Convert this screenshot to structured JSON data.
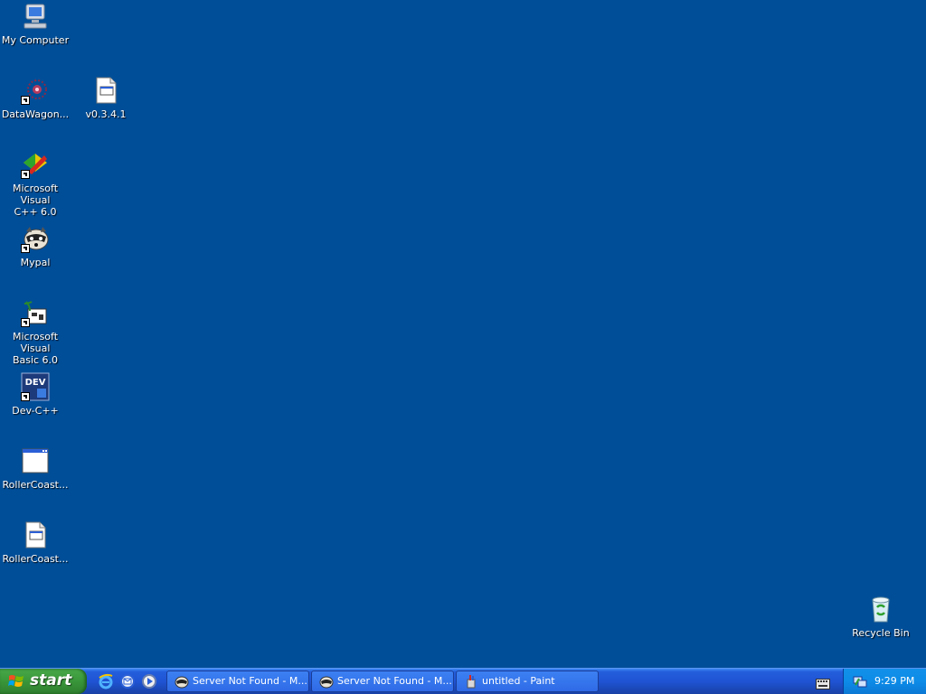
{
  "desktop": {
    "background": "#004e98",
    "icons": [
      {
        "id": "my-computer",
        "label": "My Computer"
      },
      {
        "id": "datawagon",
        "label": "DataWagon..."
      },
      {
        "id": "v0341",
        "label": "v0.3.4.1"
      },
      {
        "id": "msvc",
        "label": "Microsoft Visual\nC++ 6.0"
      },
      {
        "id": "mypal",
        "label": "Mypal"
      },
      {
        "id": "msvb",
        "label": "Microsoft Visual\nBasic 6.0"
      },
      {
        "id": "devcpp",
        "label": "Dev-C++"
      },
      {
        "id": "rollercoaster1",
        "label": "RollerCoast..."
      },
      {
        "id": "rollercoaster2",
        "label": "RollerCoast..."
      },
      {
        "id": "recycle-bin",
        "label": "Recycle Bin"
      }
    ]
  },
  "taskbar": {
    "start_label": "start",
    "quick_launch": [
      "ie-icon",
      "outlook-express-icon",
      "media-player-icon"
    ],
    "tasks": [
      {
        "label": "Server Not Found - M...",
        "icon": "mypal-icon"
      },
      {
        "label": "Server Not Found - M...",
        "icon": "mypal-icon"
      },
      {
        "label": "untitled - Paint",
        "icon": "paint-icon"
      }
    ],
    "clock": "9:29 PM",
    "tray_icons": [
      "keyboard-icon",
      "network-icon"
    ]
  }
}
